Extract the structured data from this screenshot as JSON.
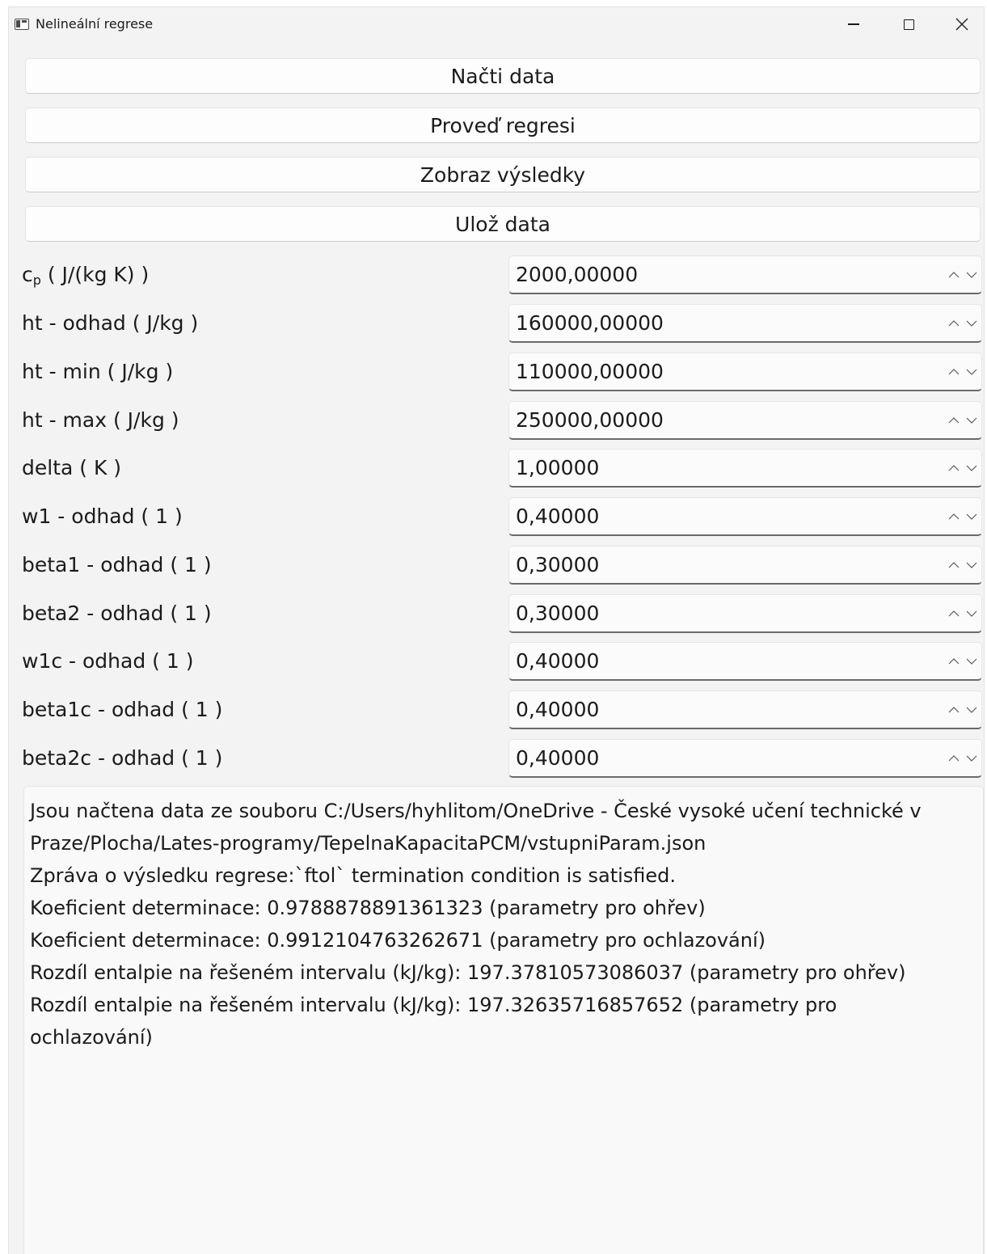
{
  "window": {
    "title": "Nelineální regrese"
  },
  "buttons": {
    "load": "Načti data",
    "regress": "Proveď regresi",
    "show": "Zobraz výsledky",
    "save": "Ulož data"
  },
  "params": [
    {
      "label_main": "c",
      "label_sub": "p",
      "label_rest": " ( J/(kg K) )",
      "value": "2000,00000"
    },
    {
      "label": "ht - odhad ( J/kg )",
      "value": "160000,00000"
    },
    {
      "label": "ht - min ( J/kg )",
      "value": "110000,00000"
    },
    {
      "label": "ht - max ( J/kg )",
      "value": "250000,00000"
    },
    {
      "label": "delta ( K )",
      "value": "1,00000"
    },
    {
      "label": "w1 - odhad ( 1 )",
      "value": "0,40000"
    },
    {
      "label": "beta1 - odhad ( 1 )",
      "value": "0,30000"
    },
    {
      "label": "beta2 - odhad ( 1 )",
      "value": "0,30000"
    },
    {
      "label": "w1c - odhad ( 1 )",
      "value": "0,40000"
    },
    {
      "label": "beta1c - odhad ( 1 )",
      "value": "0,40000"
    },
    {
      "label": "beta2c - odhad ( 1 )",
      "value": "0,40000"
    }
  ],
  "output": {
    "lines": [
      "Jsou načtena data ze souboru C:/Users/hyhlitom/OneDrive - České vysoké učení technické v",
      "Praze/Plocha/Lates-programy/TepelnaKapacitaPCM/vstupniParam.json",
      "Zpráva o výsledku regrese:`ftol` termination condition is satisfied.",
      "Koeficient determinace: 0.9788878891361323 (parametry pro ohřev)",
      "Koeficient determinace: 0.9912104763262671 (parametry pro ochlazování)",
      "Rozdíl entalpie na řešeném intervalu (kJ/kg): 197.37810573086037 (parametry pro ohřev)",
      "Rozdíl entalpie na řešeném intervalu (kJ/kg): 197.32635716857652 (parametry pro",
      "ochlazování)"
    ]
  }
}
